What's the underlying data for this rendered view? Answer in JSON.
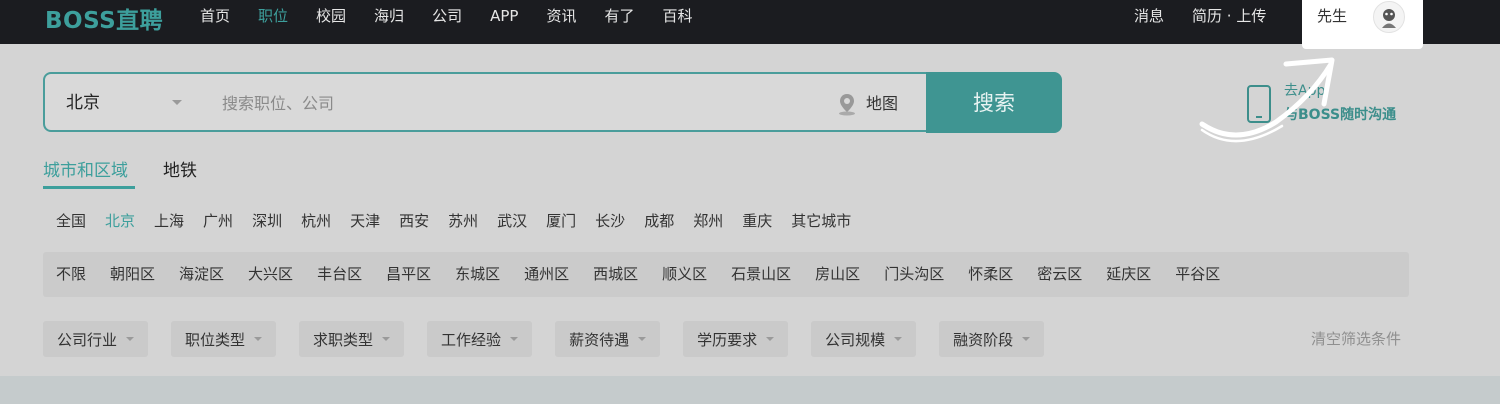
{
  "header": {
    "logo": "BOSS直聘",
    "nav": [
      "首页",
      "职位",
      "校园",
      "海归",
      "公司",
      "APP",
      "资讯",
      "有了",
      "百科"
    ],
    "active_nav_index": 1,
    "messages_label": "消息",
    "resume_label": "简历 · 上传",
    "user_name": "先生"
  },
  "search": {
    "city": "北京",
    "placeholder": "搜索职位、公司",
    "map_label": "地图",
    "button_label": "搜索"
  },
  "promo": {
    "line1": "去App",
    "line2": "与BOSS随时沟通"
  },
  "tabs": {
    "city_area": "城市和区域",
    "metro": "地铁"
  },
  "cities": [
    "全国",
    "北京",
    "上海",
    "广州",
    "深圳",
    "杭州",
    "天津",
    "西安",
    "苏州",
    "武汉",
    "厦门",
    "长沙",
    "成都",
    "郑州",
    "重庆",
    "其它城市"
  ],
  "active_city_index": 1,
  "districts": [
    "不限",
    "朝阳区",
    "海淀区",
    "大兴区",
    "丰台区",
    "昌平区",
    "东城区",
    "通州区",
    "西城区",
    "顺义区",
    "石景山区",
    "房山区",
    "门头沟区",
    "怀柔区",
    "密云区",
    "延庆区",
    "平谷区"
  ],
  "filters": [
    "公司行业",
    "职位类型",
    "求职类型",
    "工作经验",
    "薪资待遇",
    "学历要求",
    "公司规模",
    "融资阶段"
  ],
  "clear_filters": "清空筛选条件",
  "colors": {
    "brand": "#3d9f9c",
    "topbar": "#1b1c20",
    "overlay_bg": "#d4d4d4"
  }
}
